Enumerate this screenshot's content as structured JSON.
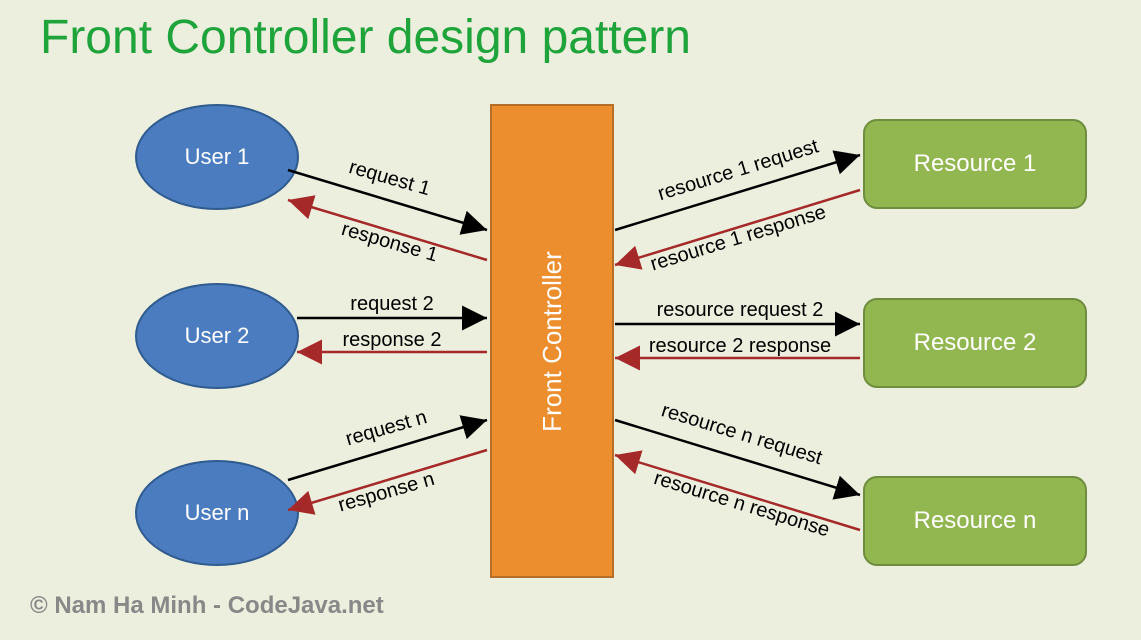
{
  "title": "Front Controller design pattern",
  "users": {
    "u1": "User 1",
    "u2": "User 2",
    "u3": "User n"
  },
  "controller": "Front Controller",
  "resources": {
    "r1": "Resource 1",
    "r2": "Resource 2",
    "r3": "Resource n"
  },
  "arrows": {
    "req1": "request 1",
    "res1": "response 1",
    "req2": "request 2",
    "res2": "response 2",
    "req3": "request n",
    "res3": "response n",
    "rreq1": "resource 1 request",
    "rres1": "resource 1 response",
    "rreq2": "resource request 2",
    "rres2": "resource 2 response",
    "rreq3": "resource n request",
    "rres3": "resource n response"
  },
  "copyright": "© Nam Ha Minh - CodeJava.net"
}
